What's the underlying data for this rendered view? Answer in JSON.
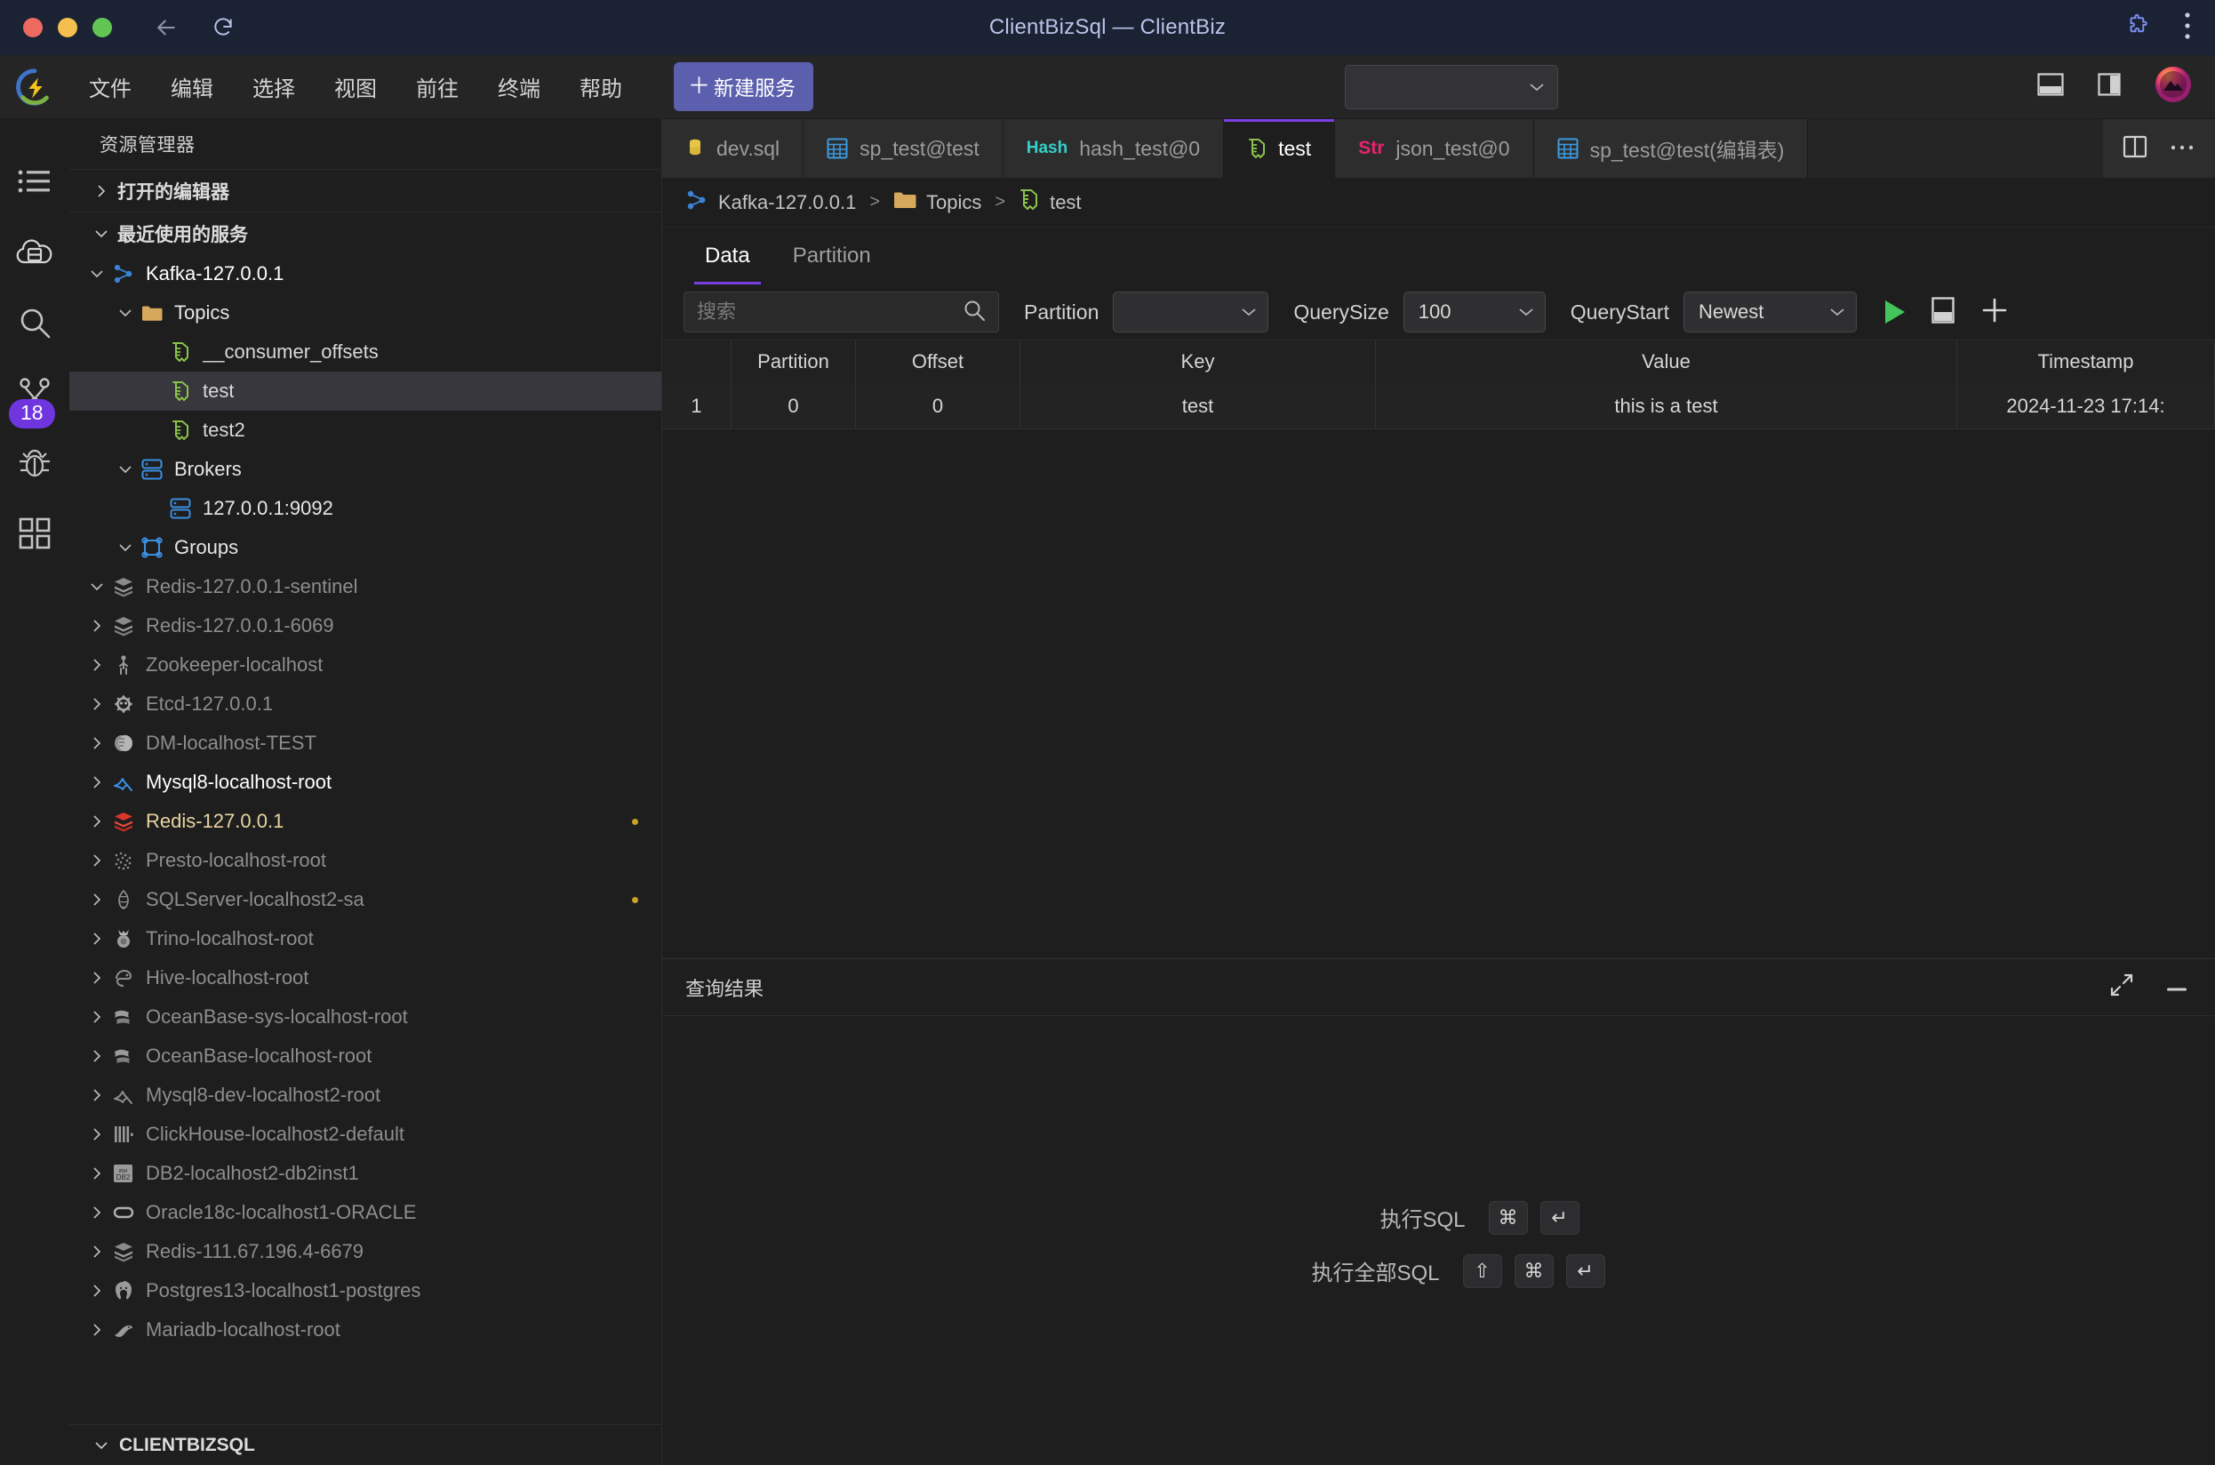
{
  "window": {
    "title": "ClientBizSql — ClientBiz",
    "traffic_lights": [
      "close",
      "minimize",
      "zoom"
    ],
    "back_icon": "back-arrow-icon",
    "reload_icon": "reload-icon",
    "extension_icon": "puzzle-icon",
    "more_icon": "kebab-menu-icon"
  },
  "menubar": {
    "logo": "clientbiz-logo",
    "items": [
      {
        "label": "文件"
      },
      {
        "label": "编辑"
      },
      {
        "label": "选择"
      },
      {
        "label": "视图"
      },
      {
        "label": "前往"
      },
      {
        "label": "终端"
      },
      {
        "label": "帮助"
      }
    ],
    "new_service_plus": "＋",
    "new_service_label": "新建服务",
    "command_center_value": "",
    "right_icons": [
      "layout-panel-icon",
      "layout-sidebar-icon",
      "account-avatar-icon"
    ]
  },
  "activitybar": {
    "items": [
      {
        "name": "explorer",
        "icon": "list-icon",
        "badge": ""
      },
      {
        "name": "database",
        "icon": "cloud-database-icon",
        "badge": ""
      },
      {
        "name": "search",
        "icon": "search-icon",
        "badge": ""
      },
      {
        "name": "source-control",
        "icon": "branch-icon",
        "badge": "18"
      },
      {
        "name": "debug",
        "icon": "bug-icon",
        "badge": ""
      },
      {
        "name": "extensions",
        "icon": "grid-squares-icon",
        "badge": ""
      }
    ]
  },
  "sidebar": {
    "title": "资源管理器",
    "sections": [
      {
        "label": "打开的编辑器",
        "expanded": false
      },
      {
        "label": "最近使用的服务",
        "expanded": true
      }
    ],
    "tree": [
      {
        "label": "Kafka-127.0.0.1",
        "icon": "kafka-icon",
        "indent": 1,
        "chevron": "down",
        "style": "white"
      },
      {
        "label": "Topics",
        "icon": "folder-icon",
        "indent": 2,
        "chevron": "down",
        "style": "bright"
      },
      {
        "label": "__consumer_offsets",
        "icon": "topic-icon",
        "indent": 3,
        "chevron": "none",
        "style": "topic"
      },
      {
        "label": "test",
        "icon": "topic-icon",
        "indent": 3,
        "chevron": "none",
        "style": "topic",
        "selected": true
      },
      {
        "label": "test2",
        "icon": "topic-icon",
        "indent": 3,
        "chevron": "none",
        "style": "topic"
      },
      {
        "label": "Brokers",
        "icon": "broker-icon",
        "indent": 2,
        "chevron": "down",
        "style": "bright"
      },
      {
        "label": "127.0.0.1:9092",
        "icon": "broker-icon",
        "indent": 3,
        "chevron": "none",
        "style": "bright"
      },
      {
        "label": "Groups",
        "icon": "groups-icon",
        "indent": 2,
        "chevron": "down",
        "style": "bright"
      },
      {
        "label": "Redis-127.0.0.1-sentinel",
        "icon": "redis-gray-icon",
        "indent": 1,
        "chevron": "down",
        "style": "dim"
      },
      {
        "label": "Redis-127.0.0.1-6069",
        "icon": "redis-gray-icon",
        "indent": 1,
        "chevron": "right",
        "style": "dim"
      },
      {
        "label": "Zookeeper-localhost",
        "icon": "zookeeper-icon",
        "indent": 1,
        "chevron": "right",
        "style": "dim"
      },
      {
        "label": "Etcd-127.0.0.1",
        "icon": "etcd-icon",
        "indent": 1,
        "chevron": "right",
        "style": "dim"
      },
      {
        "label": "DM-localhost-TEST",
        "icon": "dm-icon",
        "indent": 1,
        "chevron": "right",
        "style": "dim"
      },
      {
        "label": "Mysql8-localhost-root",
        "icon": "mysql-icon",
        "indent": 1,
        "chevron": "right",
        "style": "white"
      },
      {
        "label": "Redis-127.0.0.1",
        "icon": "redis-red-icon",
        "indent": 1,
        "chevron": "right",
        "style": "gold",
        "marker": true
      },
      {
        "label": "Presto-localhost-root",
        "icon": "presto-icon",
        "indent": 1,
        "chevron": "right",
        "style": "dim"
      },
      {
        "label": "SQLServer-localhost2-sa",
        "icon": "sqlserver-icon",
        "indent": 1,
        "chevron": "right",
        "style": "dim",
        "marker": true
      },
      {
        "label": "Trino-localhost-root",
        "icon": "trino-icon",
        "indent": 1,
        "chevron": "right",
        "style": "dim"
      },
      {
        "label": "Hive-localhost-root",
        "icon": "hive-icon",
        "indent": 1,
        "chevron": "right",
        "style": "dim"
      },
      {
        "label": "OceanBase-sys-localhost-root",
        "icon": "oceanbase-icon",
        "indent": 1,
        "chevron": "right",
        "style": "dim"
      },
      {
        "label": "OceanBase-localhost-root",
        "icon": "oceanbase-icon",
        "indent": 1,
        "chevron": "right",
        "style": "dim"
      },
      {
        "label": "Mysql8-dev-localhost2-root",
        "icon": "mysql-gray-icon",
        "indent": 1,
        "chevron": "right",
        "style": "dim"
      },
      {
        "label": "ClickHouse-localhost2-default",
        "icon": "clickhouse-icon",
        "indent": 1,
        "chevron": "right",
        "style": "dim"
      },
      {
        "label": "DB2-localhost2-db2inst1",
        "icon": "db2-icon",
        "indent": 1,
        "chevron": "right",
        "style": "dim"
      },
      {
        "label": "Oracle18c-localhost1-ORACLE",
        "icon": "oracle-icon",
        "indent": 1,
        "chevron": "right",
        "style": "dim"
      },
      {
        "label": "Redis-111.67.196.4-6679",
        "icon": "redis-gray-icon",
        "indent": 1,
        "chevron": "right",
        "style": "dim"
      },
      {
        "label": "Postgres13-localhost1-postgres",
        "icon": "postgres-icon",
        "indent": 1,
        "chevron": "right",
        "style": "dim"
      },
      {
        "label": "Mariadb-localhost-root",
        "icon": "mariadb-icon",
        "indent": 1,
        "chevron": "right",
        "style": "dim"
      }
    ],
    "bottom_section": "CLIENTBIZSQL"
  },
  "tabs": [
    {
      "label": "dev.sql",
      "icon": "sql-file-icon",
      "active": false
    },
    {
      "label": "sp_test@test",
      "icon": "table-icon",
      "active": false
    },
    {
      "label": "hash_test@0",
      "icon": "hash-icon",
      "active": false
    },
    {
      "label": "test",
      "icon": "topic-icon",
      "active": true
    },
    {
      "label": "json_test@0",
      "icon": "str-icon",
      "active": false
    },
    {
      "label": "sp_test@test(编辑表)",
      "icon": "table-icon",
      "active": false
    }
  ],
  "tabbar_actions": [
    "split-editor-icon",
    "more-actions-icon"
  ],
  "breadcrumb": [
    {
      "label": "Kafka-127.0.0.1",
      "icon": "kafka-icon"
    },
    {
      "label": "Topics",
      "icon": "folder-icon"
    },
    {
      "label": "test",
      "icon": "topic-icon"
    }
  ],
  "subtabs": [
    {
      "label": "Data",
      "active": true
    },
    {
      "label": "Partition",
      "active": false
    }
  ],
  "query_toolbar": {
    "search_placeholder": "搜索",
    "search_value": "",
    "search_icon": "search-icon",
    "partition_label": "Partition",
    "partition_value": "",
    "querysize_label": "QuerySize",
    "querysize_value": "100",
    "querystart_label": "QueryStart",
    "querystart_value": "Newest",
    "run_icon": "play-icon",
    "panel_icon": "panel-toggle-icon",
    "add_icon": "plus-icon"
  },
  "grid": {
    "columns": [
      "",
      "Partition",
      "Offset",
      "Key",
      "Value",
      "Timestamp"
    ],
    "rows": [
      {
        "index": "1",
        "partition": "0",
        "offset": "0",
        "key": "test",
        "value": "this is a test",
        "timestamp": "2024-11-23 17:14:"
      }
    ]
  },
  "result_panel": {
    "title": "查询结果",
    "expand_icon": "expand-diagonal-icon",
    "minimize_icon": "minimize-icon",
    "shortcuts": [
      {
        "label": "执行SQL",
        "keys": [
          "⌘",
          "↵"
        ]
      },
      {
        "label": "执行全部SQL",
        "keys": [
          "⇧",
          "⌘",
          "↵"
        ]
      }
    ]
  },
  "colors": {
    "accent": "#7b3fe4",
    "button": "#5b5fad",
    "badge": "#6f36e0",
    "run_green": "#43c55c",
    "selected_row": "#37373d",
    "titlebar_bg": "#1b2233"
  }
}
